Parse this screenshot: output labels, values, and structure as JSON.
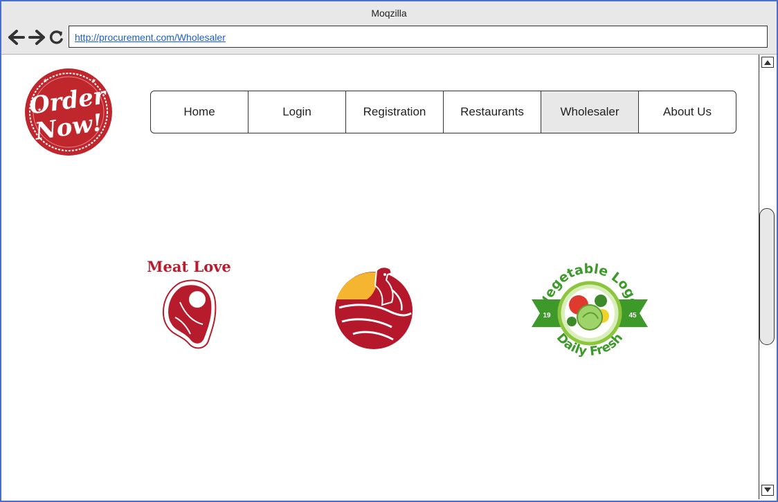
{
  "browser": {
    "title": "Moqzilla",
    "url": "http://procurement.com/Wholesaler"
  },
  "site": {
    "logo_line1": "Order",
    "logo_line2": "Now!"
  },
  "nav": {
    "items": [
      {
        "label": "Home"
      },
      {
        "label": "Login"
      },
      {
        "label": "Registration"
      },
      {
        "label": "Restaurants"
      },
      {
        "label": "Wholesaler",
        "active": true
      },
      {
        "label": "About Us"
      }
    ]
  },
  "wholesalers": {
    "meat": {
      "title": "Meat Love"
    },
    "chicken": {},
    "vegetable": {
      "title": "Vegetable Logo",
      "left_num": "19",
      "right_num": "45",
      "tagline": "Daily Fresh"
    }
  },
  "colors": {
    "window_border": "#4a6fd1",
    "chrome": "#e8e8e8",
    "link": "#1a5fd6",
    "brand_red": "#c0272d",
    "meat_red": "#b71c2c",
    "chicken_red": "#b5182b",
    "chicken_yellow": "#f5b531",
    "veg_green": "#3d9a2a"
  }
}
